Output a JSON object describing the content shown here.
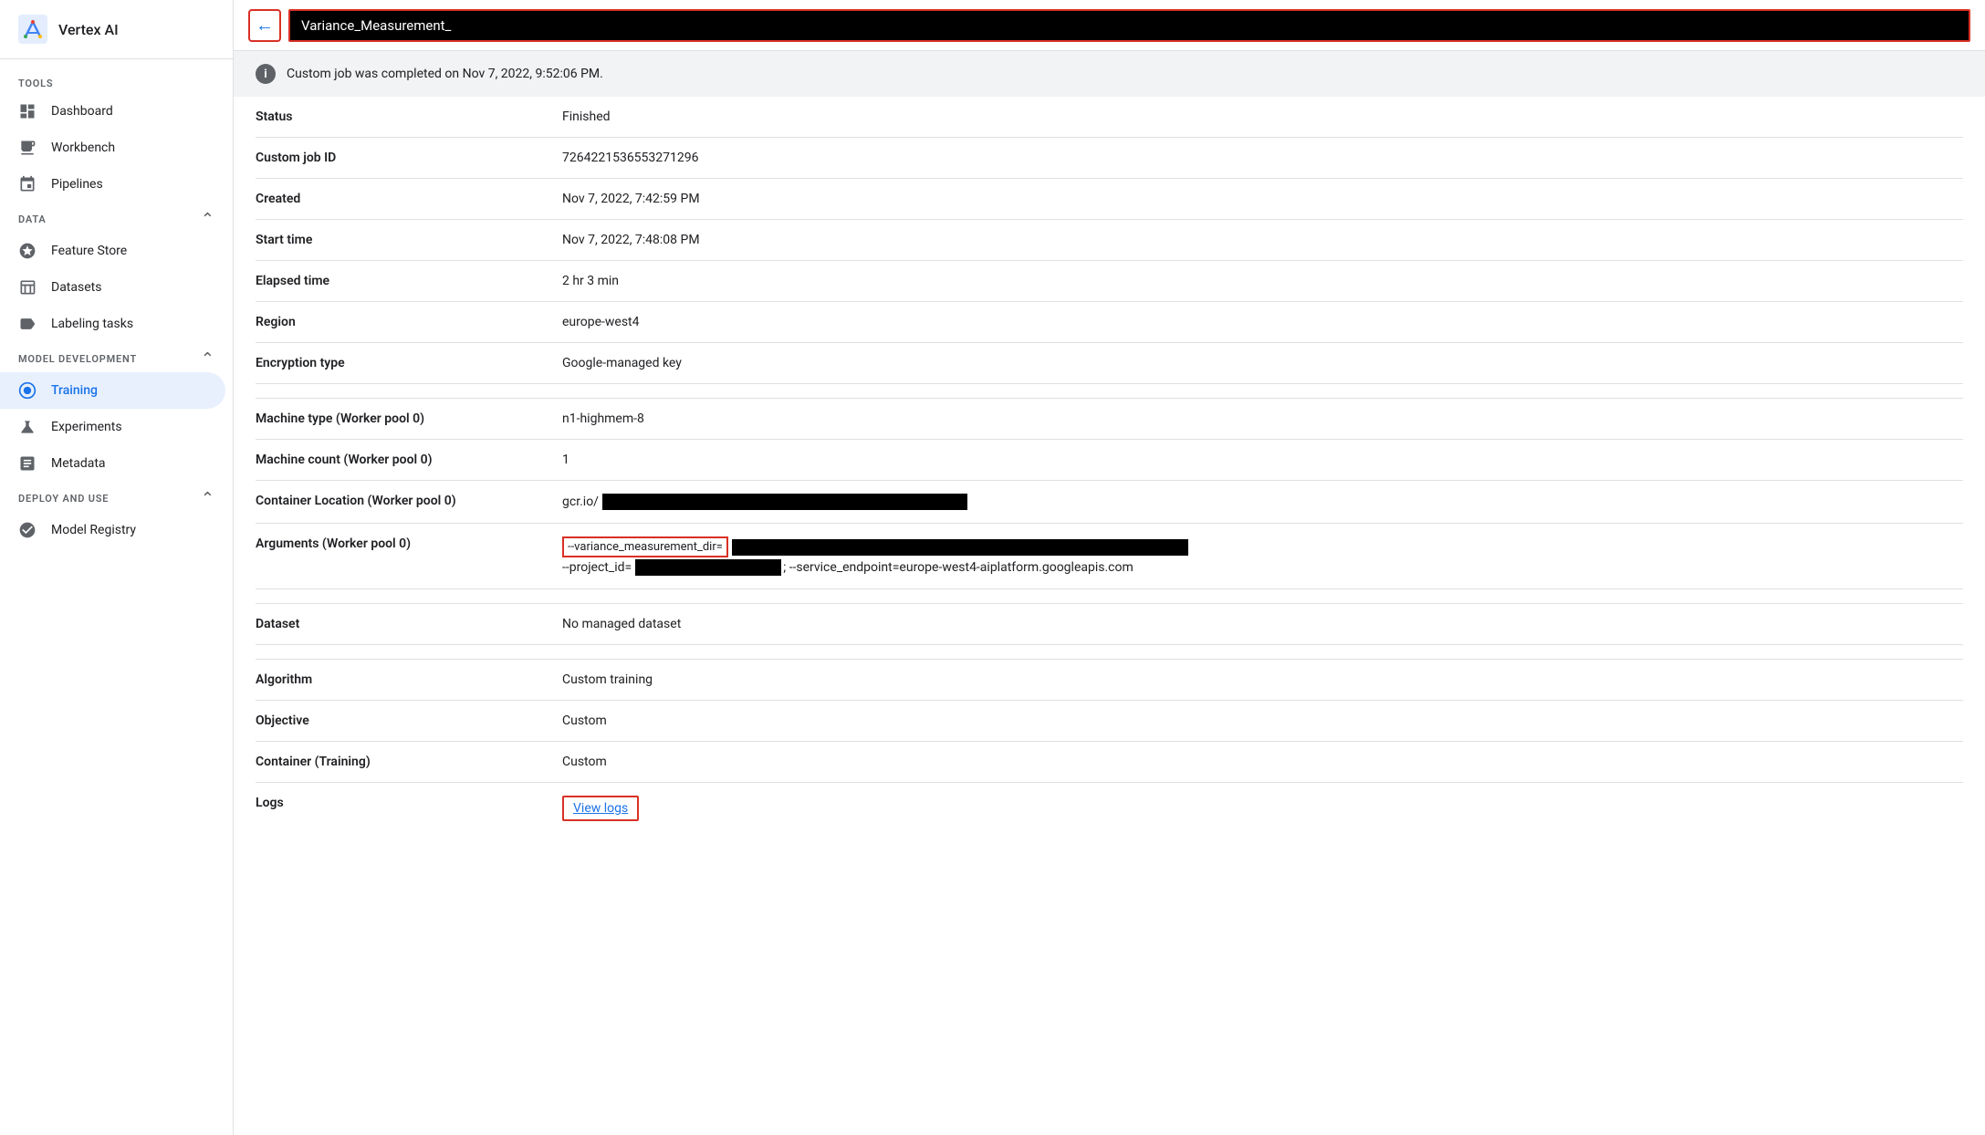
{
  "app": {
    "title": "Vertex AI"
  },
  "sidebar": {
    "tools_label": "TOOLS",
    "items_tools": [
      {
        "id": "dashboard",
        "label": "Dashboard",
        "icon": "dashboard"
      },
      {
        "id": "workbench",
        "label": "Workbench",
        "icon": "workbench"
      },
      {
        "id": "pipelines",
        "label": "Pipelines",
        "icon": "pipelines"
      }
    ],
    "data_label": "DATA",
    "items_data": [
      {
        "id": "feature-store",
        "label": "Feature Store",
        "icon": "layers"
      },
      {
        "id": "datasets",
        "label": "Datasets",
        "icon": "datasets"
      },
      {
        "id": "labeling-tasks",
        "label": "Labeling tasks",
        "icon": "label"
      }
    ],
    "model_dev_label": "MODEL DEVELOPMENT",
    "items_model_dev": [
      {
        "id": "training",
        "label": "Training",
        "icon": "training",
        "active": true
      },
      {
        "id": "experiments",
        "label": "Experiments",
        "icon": "experiments"
      },
      {
        "id": "metadata",
        "label": "Metadata",
        "icon": "metadata"
      }
    ],
    "deploy_label": "DEPLOY AND USE",
    "items_deploy": [
      {
        "id": "model-registry",
        "label": "Model Registry",
        "icon": "model-registry"
      }
    ]
  },
  "topbar": {
    "back_title": "back",
    "page_title": "Variance_Measurement_"
  },
  "banner": {
    "message": "Custom job was completed on Nov 7, 2022, 9:52:06 PM."
  },
  "details": [
    {
      "id": "status",
      "label": "Status",
      "value": "Finished",
      "type": "text"
    },
    {
      "id": "custom-job-id",
      "label": "Custom job ID",
      "value": "7264221536553271296",
      "type": "text"
    },
    {
      "id": "created",
      "label": "Created",
      "value": "Nov 7, 2022, 7:42:59 PM",
      "type": "text"
    },
    {
      "id": "start-time",
      "label": "Start time",
      "value": "Nov 7, 2022, 7:48:08 PM",
      "type": "text"
    },
    {
      "id": "elapsed-time",
      "label": "Elapsed time",
      "value": "2 hr 3 min",
      "type": "text"
    },
    {
      "id": "region",
      "label": "Region",
      "value": "europe-west4",
      "type": "text"
    },
    {
      "id": "encryption-type",
      "label": "Encryption type",
      "value": "Google-managed key",
      "type": "text"
    }
  ],
  "worker_details": [
    {
      "id": "machine-type",
      "label": "Machine type (Worker pool 0)",
      "value": "n1-highmem-8",
      "type": "text"
    },
    {
      "id": "machine-count",
      "label": "Machine count (Worker pool 0)",
      "value": "1",
      "type": "text"
    },
    {
      "id": "container-location",
      "label": "Container Location (Worker pool 0)",
      "value": "gcr.io/",
      "type": "gcr"
    },
    {
      "id": "arguments",
      "label": "Arguments (Worker pool 0)",
      "value": "--variance_measurement_dir=",
      "type": "args"
    }
  ],
  "dataset_details": [
    {
      "id": "dataset",
      "label": "Dataset",
      "value": "No managed dataset",
      "type": "text"
    }
  ],
  "algo_details": [
    {
      "id": "algorithm",
      "label": "Algorithm",
      "value": "Custom training",
      "type": "text"
    },
    {
      "id": "objective",
      "label": "Objective",
      "value": "Custom",
      "type": "text"
    },
    {
      "id": "container-training",
      "label": "Container (Training)",
      "value": "Custom",
      "type": "text"
    },
    {
      "id": "logs",
      "label": "Logs",
      "value": "View logs",
      "type": "link"
    }
  ]
}
